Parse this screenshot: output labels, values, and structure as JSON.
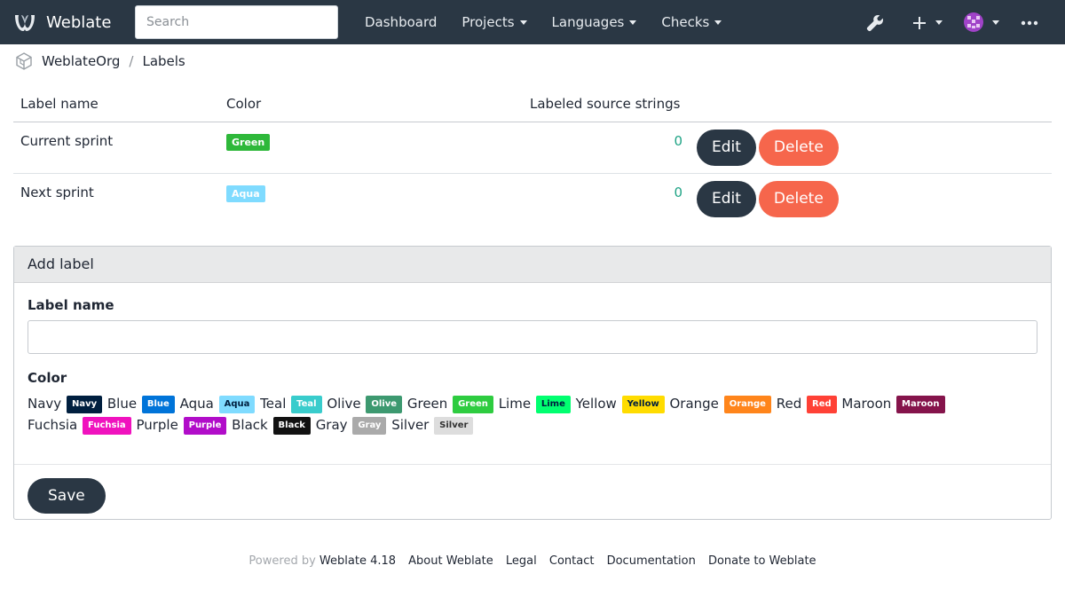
{
  "app": {
    "name": "Weblate",
    "search_placeholder": "Search"
  },
  "nav": {
    "dashboard": "Dashboard",
    "projects": "Projects",
    "languages": "Languages",
    "checks": "Checks"
  },
  "icons": {
    "logo": "weblate-logo-icon",
    "wrench": "wrench-icon",
    "plus": "plus-icon",
    "avatar": "avatar-icon",
    "more": "ellipsis-icon",
    "org": "organization-icon"
  },
  "breadcrumb": {
    "org": "WeblateOrg",
    "current": "Labels"
  },
  "table": {
    "headers": {
      "name": "Label name",
      "color": "Color",
      "count": "Labeled source strings"
    },
    "rows": [
      {
        "name": "Current sprint",
        "color": "Green",
        "color_hex": "#2eb83a",
        "count": "0",
        "edit": "Edit",
        "delete": "Delete"
      },
      {
        "name": "Next sprint",
        "color": "Aqua",
        "color_hex": "#7fdbff",
        "count": "0",
        "edit": "Edit",
        "delete": "Delete"
      }
    ]
  },
  "add_panel": {
    "title": "Add label",
    "name_label": "Label name",
    "name_value": "",
    "color_label": "Color",
    "save": "Save",
    "colors": [
      {
        "name": "Navy",
        "hex": "#001f3f",
        "text": "#ffffff"
      },
      {
        "name": "Blue",
        "hex": "#0074d9",
        "text": "#ffffff"
      },
      {
        "name": "Aqua",
        "hex": "#7fdbff",
        "text": "#001f3f"
      },
      {
        "name": "Teal",
        "hex": "#39cccc",
        "text": "#ffffff"
      },
      {
        "name": "Olive",
        "hex": "#3d9970",
        "text": "#ffffff"
      },
      {
        "name": "Green",
        "hex": "#2ecc40",
        "text": "#ffffff"
      },
      {
        "name": "Lime",
        "hex": "#01ff70",
        "text": "#001f3f"
      },
      {
        "name": "Yellow",
        "hex": "#ffdc00",
        "text": "#001f3f"
      },
      {
        "name": "Orange",
        "hex": "#ff851b",
        "text": "#ffffff"
      },
      {
        "name": "Red",
        "hex": "#ff4136",
        "text": "#ffffff"
      },
      {
        "name": "Maroon",
        "hex": "#85144b",
        "text": "#ffffff"
      },
      {
        "name": "Fuchsia",
        "hex": "#f012be",
        "text": "#ffffff"
      },
      {
        "name": "Purple",
        "hex": "#b10dc9",
        "text": "#ffffff"
      },
      {
        "name": "Black",
        "hex": "#111111",
        "text": "#ffffff"
      },
      {
        "name": "Gray",
        "hex": "#aaaaaa",
        "text": "#ffffff"
      },
      {
        "name": "Silver",
        "hex": "#dddddd",
        "text": "#333333"
      }
    ]
  },
  "footer": {
    "powered": "Powered by",
    "version": "Weblate 4.18",
    "about": "About Weblate",
    "legal": "Legal",
    "contact": "Contact",
    "docs": "Documentation",
    "donate": "Donate to Weblate"
  },
  "colors": {
    "navbar": "#2a3744",
    "dark_button": "#2a3744",
    "danger": "#f6664c",
    "link_accent": "#1fa385"
  }
}
